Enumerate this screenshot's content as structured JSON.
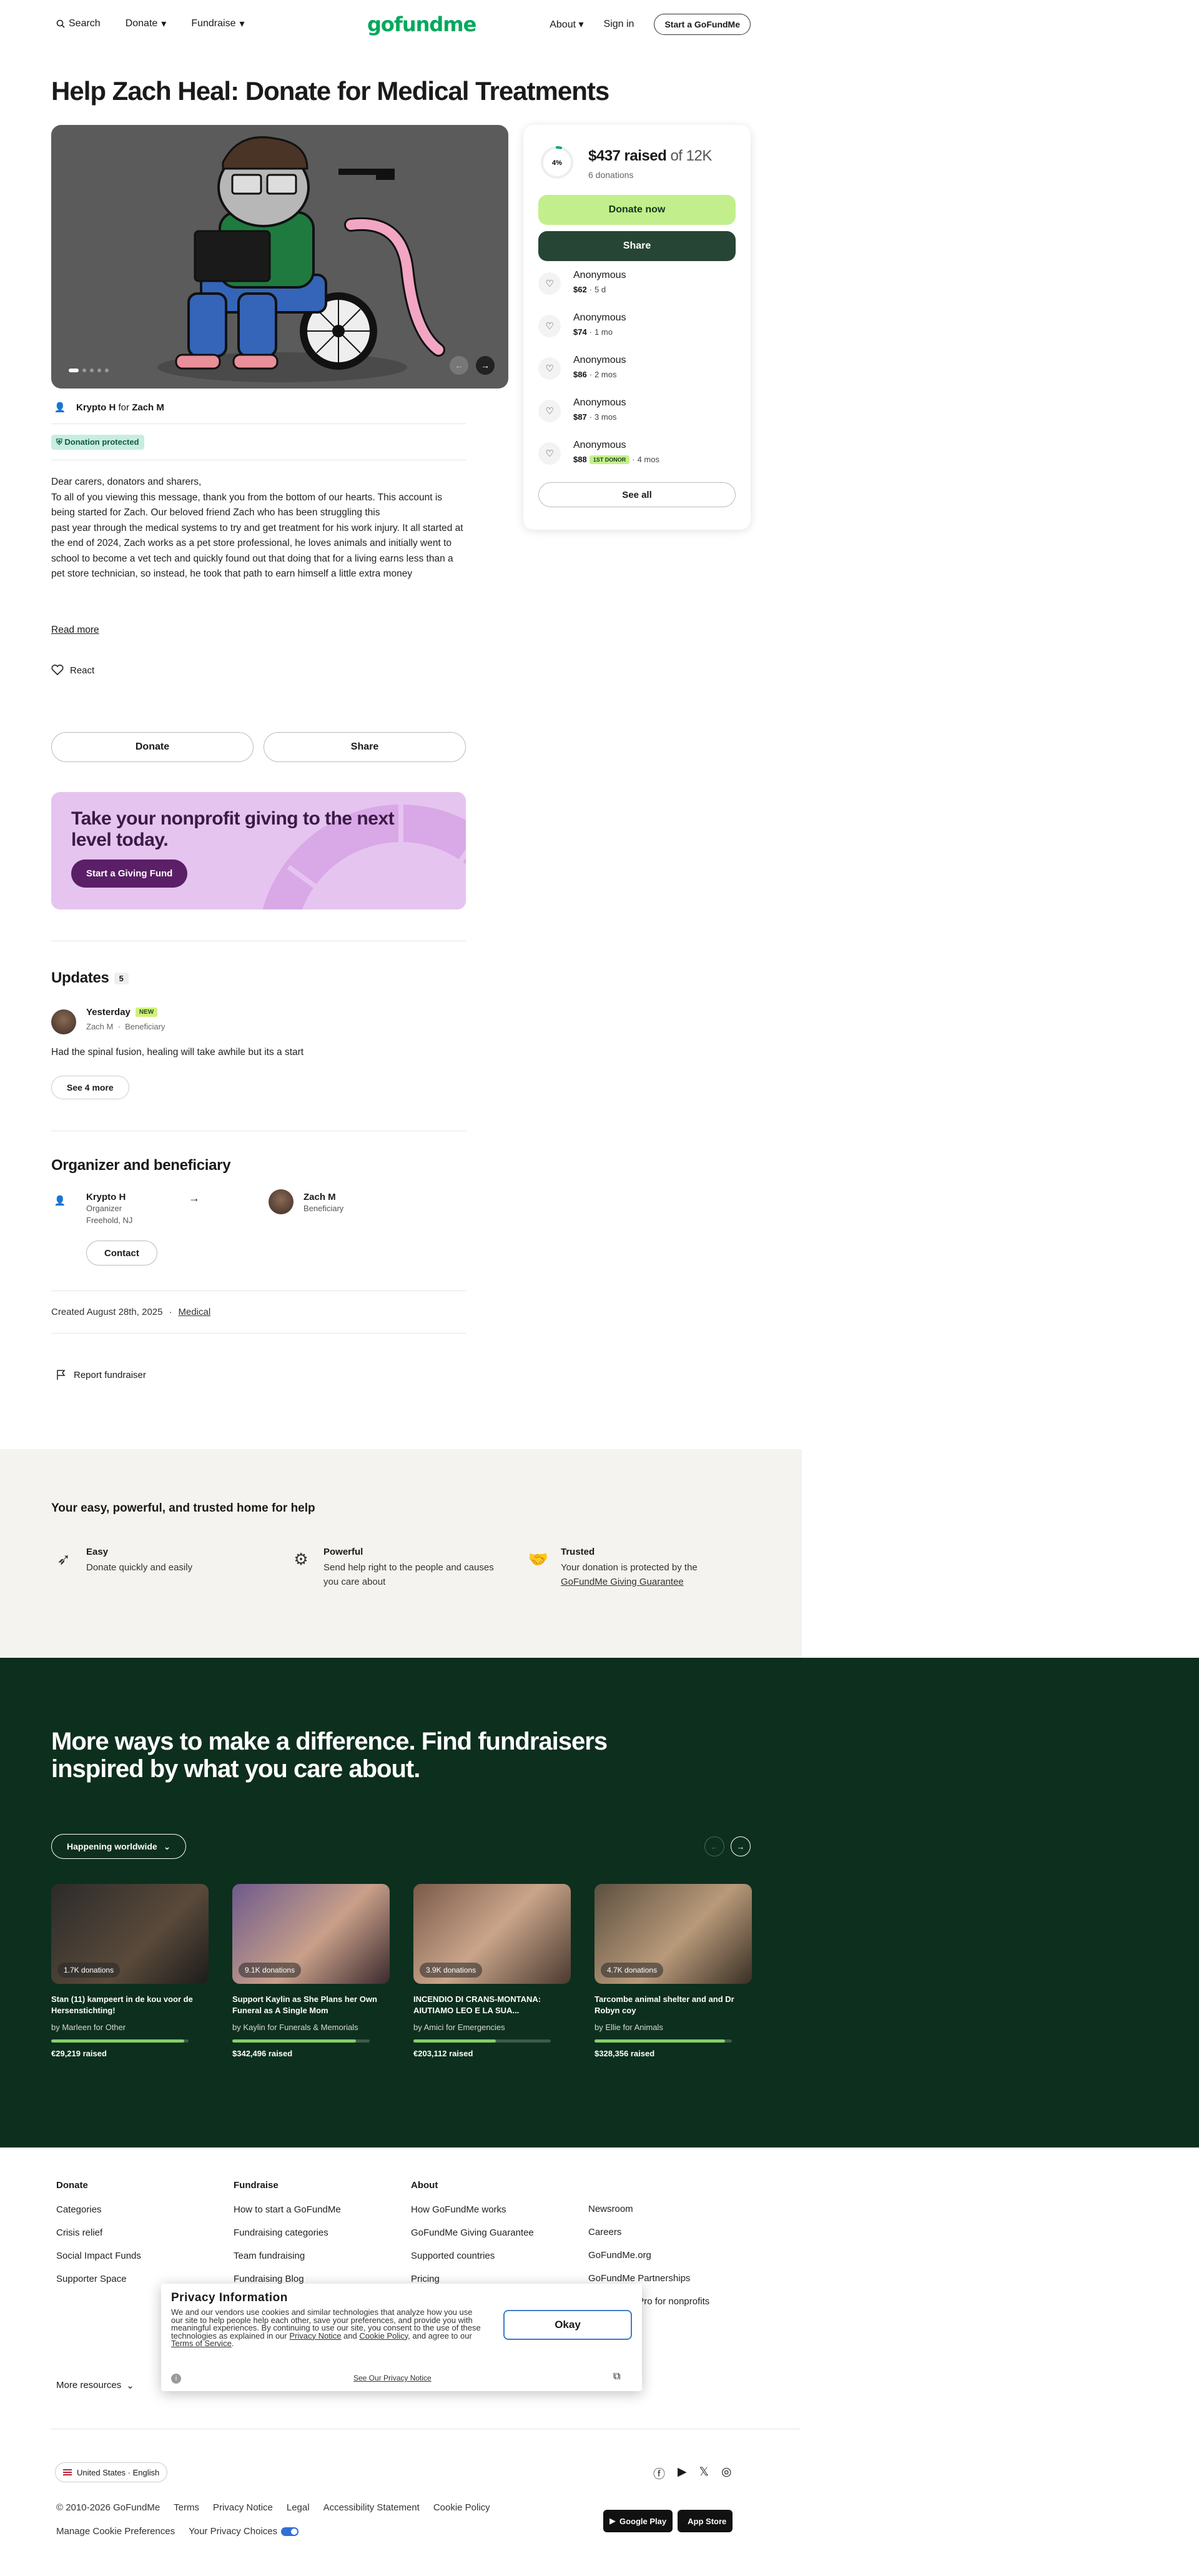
{
  "header": {
    "search": "Search",
    "donate": "Donate",
    "fundraise": "Fundraise",
    "logo": "gofundme",
    "about": "About",
    "sign_in": "Sign in",
    "start": "Start a GoFundMe"
  },
  "campaign": {
    "title": "Help Zach Heal: Donate for Medical Treatments",
    "organizer": "Krypto H",
    "for_word": "for",
    "beneficiary": "Zach M",
    "protected": "Donation protected",
    "story": "Dear carers, donators and sharers,\nTo all of you viewing this message, thank you from the bottom of our hearts. This account is being started for Zach. Our beloved friend Zach who has been struggling this\npast year through the medical systems to try and get treatment for his work injury. It all started at\nthe end of 2024, Zach works as a pet store professional, he loves animals and initially went to\nschool to become a vet tech and quickly found out that doing that for a living earns less than a\npet store technician, so instead, he took that path to earn himself a little extra money",
    "read_more": "Read more",
    "react": "React",
    "donate_btn": "Donate",
    "share_btn": "Share"
  },
  "promo": {
    "title": "Take your nonprofit giving to the next level today.",
    "button": "Start a Giving Fund"
  },
  "updates": {
    "title": "Updates",
    "count": "5",
    "date": "Yesterday",
    "new_badge": "NEW",
    "author": "Zach M",
    "author_role": "Beneficiary",
    "text": "Had the spinal fusion, healing will take awhile but its a start",
    "see_more": "See 4 more"
  },
  "org_section": {
    "title": "Organizer and beneficiary",
    "organizer_name": "Krypto H",
    "organizer_role": "Organizer",
    "organizer_loc": "Freehold, NJ",
    "beneficiary_name": "Zach M",
    "beneficiary_role": "Beneficiary",
    "contact": "Contact",
    "created": "Created August 28th, 2025",
    "category": "Medical",
    "report": "Report fundraiser"
  },
  "sidebar": {
    "percent": "4%",
    "raised": "$437 raised",
    "goal": "of 12K",
    "progress": 0.04,
    "donations": "6 donations",
    "donate_now": "Donate now",
    "share": "Share",
    "donors": [
      {
        "name": "Anonymous",
        "amount": "$62",
        "time": "5 d",
        "first": ""
      },
      {
        "name": "Anonymous",
        "amount": "$74",
        "time": "1 mo",
        "first": ""
      },
      {
        "name": "Anonymous",
        "amount": "$86",
        "time": "2 mos",
        "first": ""
      },
      {
        "name": "Anonymous",
        "amount": "$87",
        "time": "3 mos",
        "first": ""
      },
      {
        "name": "Anonymous",
        "amount": "$88",
        "time": "4 mos",
        "first": "1ST DONOR"
      }
    ],
    "see_all": "See all"
  },
  "trust": {
    "title": "Your easy, powerful, and trusted home for help",
    "items": [
      {
        "title": "Easy",
        "desc": "Donate quickly and easily",
        "link": ""
      },
      {
        "title": "Powerful",
        "desc": "Send help right to the people and causes you care about",
        "link": ""
      },
      {
        "title": "Trusted",
        "desc": "Your donation is protected by the",
        "link": "GoFundMe Giving Guarantee"
      }
    ]
  },
  "discover": {
    "title": "More ways to make a difference. Find fundraisers inspired by what you care about.",
    "filter": "Happening worldwide",
    "cards": [
      {
        "donations": "1.7K donations",
        "title": "Stan (11) kampeert in de kou voor de Hersenstichting!",
        "by": "by Marleen for Other",
        "raised": "€29,219 raised",
        "progress": 0.97
      },
      {
        "donations": "9.1K donations",
        "title": "Support Kaylin as She Plans her Own Funeral as A Single Mom",
        "by": "by Kaylin for Funerals & Memorials",
        "raised": "$342,496 raised",
        "progress": 0.9
      },
      {
        "donations": "3.9K donations",
        "title": "INCENDIO DI CRANS-MONTANA: AIUTIAMO LEO E LA SUA...",
        "by": "by Amici for Emergencies",
        "raised": "€203,112 raised",
        "progress": 0.6
      },
      {
        "donations": "4.7K donations",
        "title": "Tarcombe animal shelter and and Dr Robyn coy",
        "by": "by Ellie for Animals",
        "raised": "$328,356 raised",
        "progress": 0.95
      }
    ]
  },
  "footer": {
    "cols": [
      {
        "title": "Donate",
        "links": [
          "Categories",
          "Crisis relief",
          "Social Impact Funds",
          "Supporter Space"
        ]
      },
      {
        "title": "Fundraise",
        "links": [
          "How to start a GoFundMe",
          "Fundraising categories",
          "Team fundraising",
          "Fundraising Blog"
        ]
      },
      {
        "title": "About",
        "links": [
          "How GoFundMe works",
          "GoFundMe Giving Guarantee",
          "Supported countries",
          "Pricing"
        ]
      },
      {
        "title": "",
        "links": [
          "Newsroom",
          "Careers",
          "GoFundMe.org",
          "GoFundMe Partnerships",
          "GoFundMe Pro for nonprofits"
        ]
      }
    ],
    "more_resources": "More resources",
    "locale": "United States · English",
    "copyright": "© 2010-2026 GoFundMe",
    "legal": [
      "Terms",
      "Privacy Notice",
      "Legal",
      "Accessibility Statement",
      "Cookie Policy"
    ],
    "manage_cookies": "Manage Cookie Preferences",
    "privacy_choices": "Your Privacy Choices",
    "google_play": "Google Play",
    "app_store": "App Store"
  },
  "privacy": {
    "title": "Privacy Information",
    "text_a": "We and our vendors use cookies and similar technologies that analyze how you use our site to help people help each other, save your preferences, and provide you with meaningful experiences. By continuing to use our site, you consent to the use of these technologies as explained in our ",
    "privacy_link": "Privacy Notice",
    "and": " and ",
    "cookie_link": "Cookie Policy",
    "text_b": ", and agree to our ",
    "terms_link": "Terms of Service",
    "dot": ".",
    "okay": "Okay",
    "see_notice": "See Our Privacy Notice"
  },
  "colors": {
    "brand_green": "#02a95c",
    "donate_now_bg": "#c2ef8c",
    "share_bg": "#274534",
    "dark_section": "#0d2f1e",
    "promo_bg": "#e6c4f0"
  }
}
